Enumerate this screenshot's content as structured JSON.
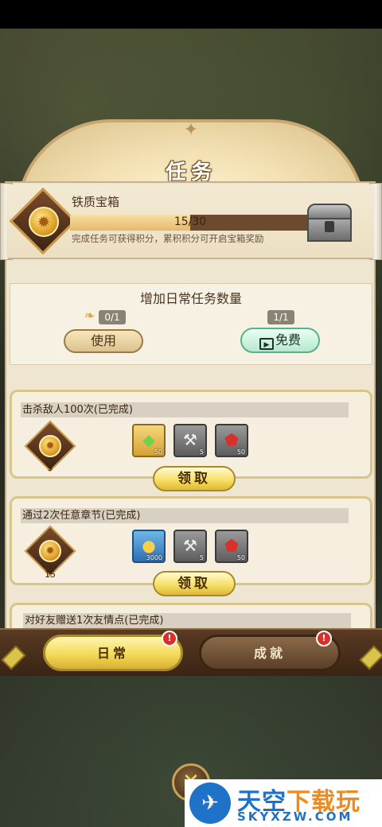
{
  "header": {
    "title": "任务"
  },
  "chest": {
    "name": "铁质宝箱",
    "progress_text": "15/30",
    "progress_fraction": 0.5,
    "description": "完成任务可获得积分，累积积分可开启宝箱奖励"
  },
  "add_tasks": {
    "title": "增加日常任务数量",
    "use": {
      "count": "0/1",
      "label": "使用"
    },
    "free": {
      "count": "1/1",
      "label": "免费"
    }
  },
  "tasks": [
    {
      "title": "击杀敌人100次(已完成)",
      "points": "5",
      "rewards": [
        {
          "icon": "green-gem-icon",
          "qty": "50"
        },
        {
          "icon": "hammer-icon",
          "qty": "5"
        },
        {
          "icon": "red-badge-icon",
          "qty": "50"
        }
      ],
      "claim_label": "领取"
    },
    {
      "title": "通过2次任意章节(已完成)",
      "points": "15",
      "rewards": [
        {
          "icon": "gold-coin-icon",
          "qty": "3000"
        },
        {
          "icon": "hammer-icon",
          "qty": "5"
        },
        {
          "icon": "red-badge-icon",
          "qty": "50"
        }
      ],
      "claim_label": "领取"
    }
  ],
  "partial_task": {
    "title": "对好友赠送1次友情点(已完成)"
  },
  "tabs": {
    "daily": "日常",
    "achievement": "成就"
  },
  "alerts": {
    "daily": "!",
    "achievement": "!"
  },
  "watermark": {
    "cn_a": "天空",
    "cn_b": "下载玩",
    "en": "SKYXZW.COM"
  }
}
